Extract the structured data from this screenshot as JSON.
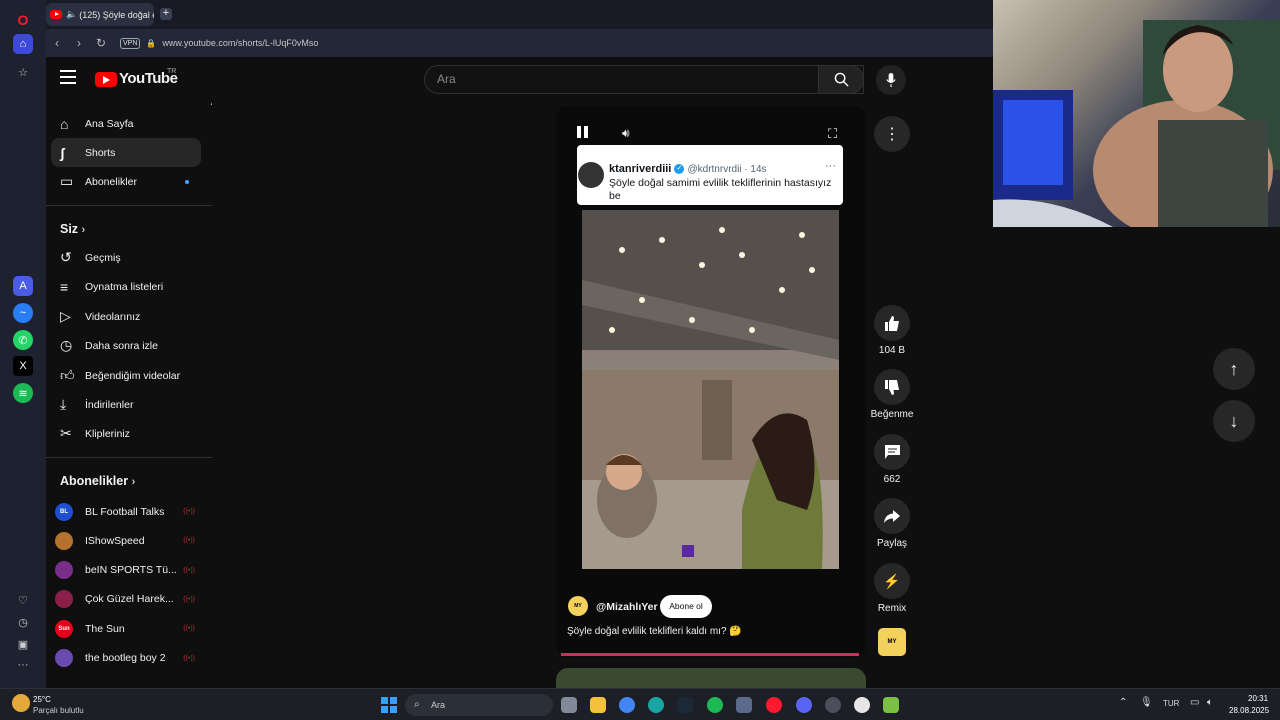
{
  "browser": {
    "tab_title": "(125) Şöyle doğal evlilik",
    "url": "www.youtube.com/shorts/L-lUqF0vMso",
    "vpn_label": "VPN"
  },
  "youtube": {
    "logo_text": "YouTube",
    "region": "TR",
    "search_placeholder": "Ara"
  },
  "guide": {
    "main": [
      {
        "label": "Ana Sayfa"
      },
      {
        "label": "Shorts"
      },
      {
        "label": "Abonelikler"
      }
    ],
    "you_header": "Siz",
    "you": [
      {
        "label": "Geçmiş"
      },
      {
        "label": "Oynatma listeleri"
      },
      {
        "label": "Videolarınız"
      },
      {
        "label": "Daha sonra izle"
      },
      {
        "label": "Beğendiğim videolar"
      },
      {
        "label": "İndirilenler"
      },
      {
        "label": "Klipleriniz"
      }
    ],
    "subs_header": "Abonelikler",
    "subs": [
      {
        "label": "BL Football Talks",
        "avatar": "BL",
        "color": "#1e4fd1"
      },
      {
        "label": "IShowSpeed",
        "avatar": "",
        "color": "#b5722d"
      },
      {
        "label": "beIN SPORTS Tü...",
        "avatar": "",
        "color": "#7b2d8a"
      },
      {
        "label": "Çok Güzel Harek...",
        "avatar": "",
        "color": "#8a1f4a"
      },
      {
        "label": "The Sun",
        "avatar": "Sun",
        "color": "#e2001a"
      },
      {
        "label": "the bootleg boy 2",
        "avatar": "",
        "color": "#6a4bb0"
      }
    ]
  },
  "short": {
    "tweet_name": "ktanriverdiii",
    "tweet_handle": "@kdrtnrvrdii · 14s",
    "tweet_text": "Şöyle doğal samimi evlilik tekliflerinin hastasıyız be",
    "channel": "@MizahlıYer",
    "subscribe_label": "Abone ol",
    "caption": "Şöyle doğal evlilik teklifleri kaldı mı? 🤔",
    "progress": 1.0
  },
  "actions": {
    "likes": "104 B",
    "dislike_label": "Beğenme",
    "comments": "662",
    "share_label": "Paylaş",
    "remix_label": "Remix"
  },
  "taskbar": {
    "temp": "25°C",
    "weather": "Parçalı bulutlu",
    "search": "Ara",
    "lang": "TUR",
    "time": "20:31",
    "date": "28.08.2025"
  }
}
